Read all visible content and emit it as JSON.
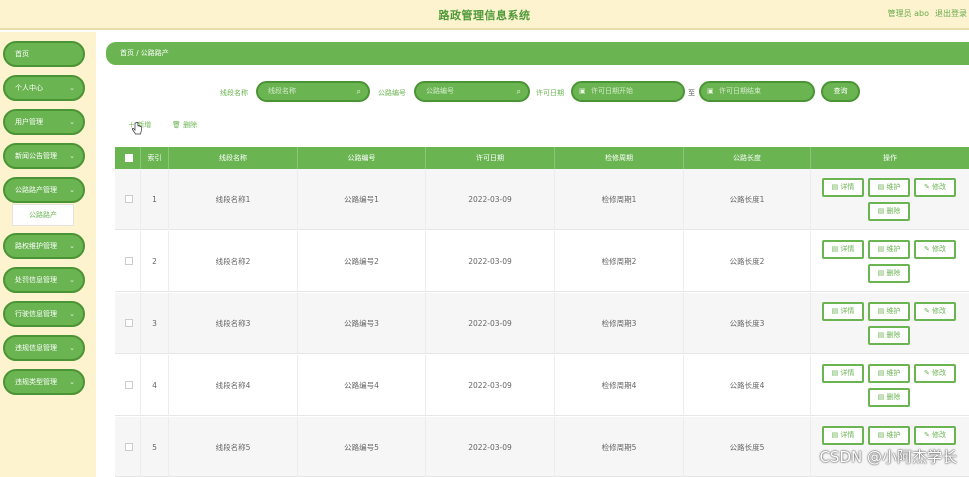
{
  "header": {
    "title": "路政管理信息系统",
    "user": "管理员 abo",
    "logout": "退出登录"
  },
  "sidebar": {
    "items": [
      {
        "label": "首页",
        "chevron": false
      },
      {
        "label": "个人中心",
        "chevron": true
      },
      {
        "label": "用户管理",
        "chevron": true
      },
      {
        "label": "新闻公告管理",
        "chevron": true
      },
      {
        "label": "公路路产管理",
        "chevron": true
      },
      {
        "label": "路权维护管理",
        "chevron": true
      },
      {
        "label": "处罚信息管理",
        "chevron": true
      },
      {
        "label": "行驶信息管理",
        "chevron": true
      },
      {
        "label": "违规信息管理",
        "chevron": true
      },
      {
        "label": "违规类型管理",
        "chevron": true
      }
    ],
    "submenu_label": "公路路产"
  },
  "breadcrumb": "首页 / 公路路产",
  "search": {
    "label_road": "线段名称",
    "placeholder_road": "线段名称",
    "label_number": "公路编号",
    "placeholder_number": "公路编号",
    "label_date": "许可日期",
    "placeholder_start": "许可日期开始",
    "range_sep": "至",
    "placeholder_end": "许可日期结束",
    "query_button": "查询"
  },
  "toolbar": {
    "add": "新增",
    "delete": "删除"
  },
  "table": {
    "headers": [
      "索引",
      "线段名称",
      "公路编号",
      "许可日期",
      "检修周期",
      "公路长度",
      "操作"
    ],
    "rows": [
      [
        "1",
        "线段名称1",
        "公路编号1",
        "2022-03-09",
        "检修周期1",
        "公路长度1"
      ],
      [
        "2",
        "线段名称2",
        "公路编号2",
        "2022-03-09",
        "检修周期2",
        "公路长度2"
      ],
      [
        "3",
        "线段名称3",
        "公路编号3",
        "2022-03-09",
        "检修周期3",
        "公路长度3"
      ],
      [
        "4",
        "线段名称4",
        "公路编号4",
        "2022-03-09",
        "检修周期4",
        "公路长度4"
      ],
      [
        "5",
        "线段名称5",
        "公路编号5",
        "2022-03-09",
        "检修周期5",
        "公路长度5"
      ]
    ],
    "actions": [
      "详情",
      "维护",
      "修改",
      "删除"
    ]
  },
  "watermark": "CSDN @小阿杰学长",
  "colors": {
    "accent": "#6ab452",
    "accent_dark": "#4b9435",
    "sidebar_bg": "#fdf3cf"
  }
}
